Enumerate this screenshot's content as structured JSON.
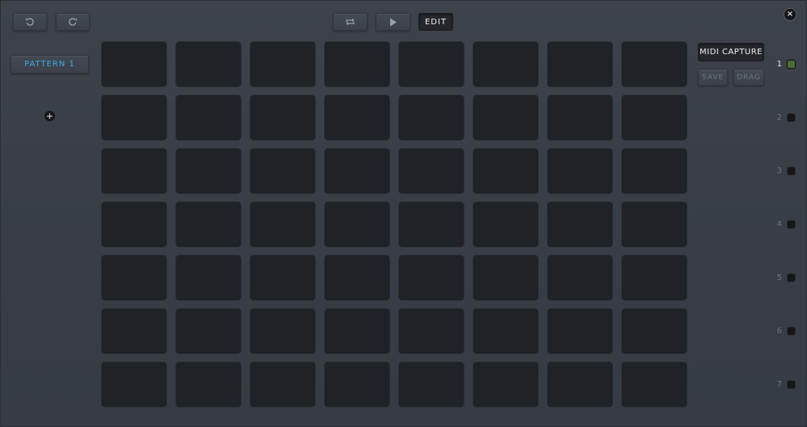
{
  "toolbar": {
    "undo_icon": "undo-icon",
    "redo_icon": "redo-icon",
    "loop_icon": "loop-icon",
    "play_icon": "play-icon",
    "edit_label": "EDIT",
    "close_icon": "close-icon"
  },
  "patterns": {
    "items": [
      {
        "label": "PATTERN 1",
        "active": true
      }
    ],
    "add_icon": "plus-icon"
  },
  "capture": {
    "midi_capture_label": "MIDI CAPTURE",
    "save_label": "SAVE",
    "drag_label": "DRAG"
  },
  "grid": {
    "rows": 7,
    "columns": 8
  },
  "rows": [
    {
      "label": "1",
      "active": true
    },
    {
      "label": "2",
      "active": false
    },
    {
      "label": "3",
      "active": false
    },
    {
      "label": "4",
      "active": false
    },
    {
      "label": "5",
      "active": false
    },
    {
      "label": "6",
      "active": false
    },
    {
      "label": "7",
      "active": false
    }
  ],
  "colors": {
    "accent": "#3aa7e0",
    "pad": "#1f2226",
    "led_on": "#4a6a32"
  }
}
